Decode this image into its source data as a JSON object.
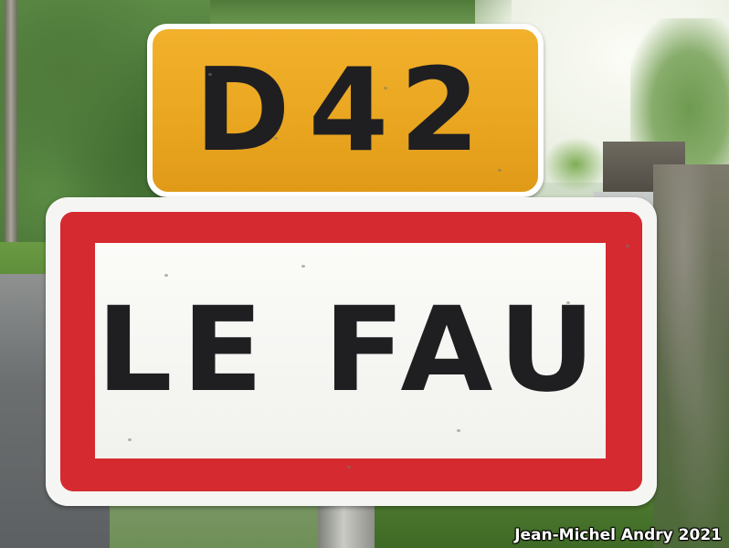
{
  "route_plate": {
    "letter": "D",
    "number": "42",
    "color": "#f0ad2a"
  },
  "town_sign": {
    "name": "LE FAU",
    "border_color": "#d52a30"
  },
  "watermark": {
    "text": "Jean-Michel Andry 2021"
  }
}
